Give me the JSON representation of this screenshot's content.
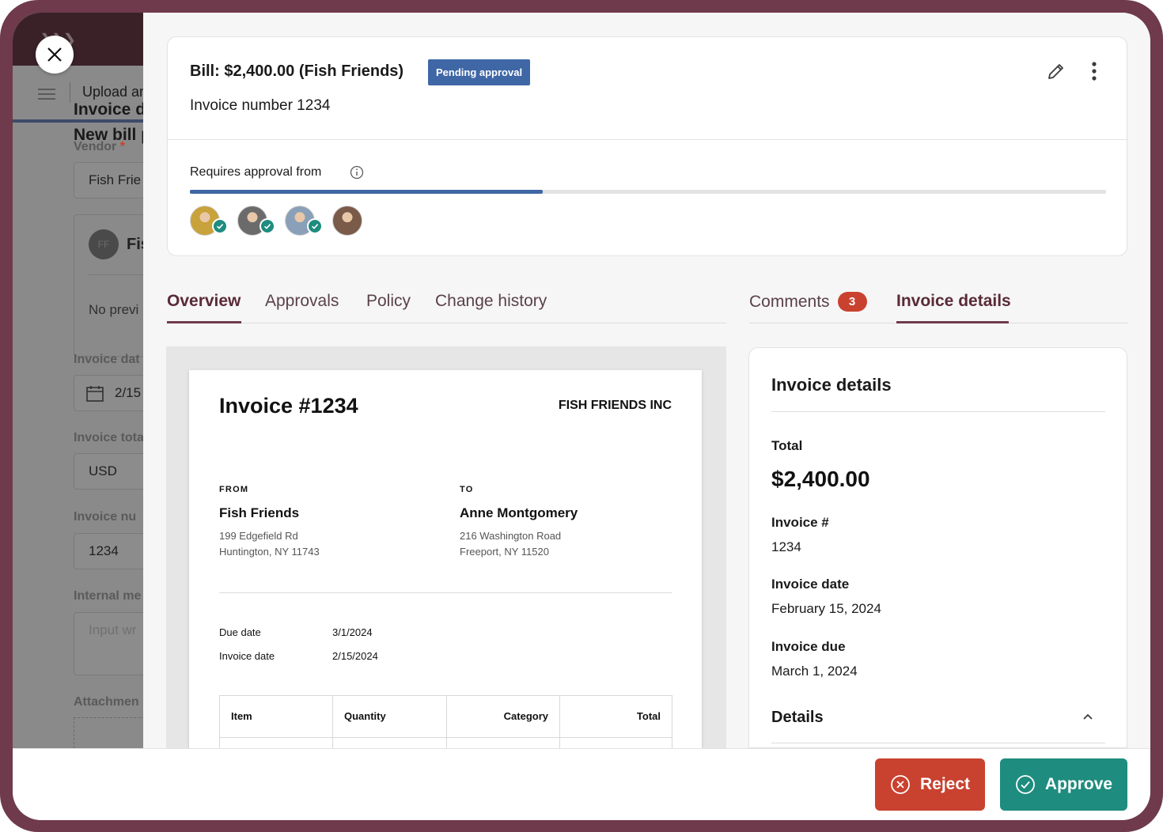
{
  "background_page": {
    "nav_title_1": "Upload an",
    "nav_title_2": "Invoice de",
    "heading": "New bill p",
    "vendor_label": "Vendor",
    "vendor_required": "*",
    "vendor_value": "Fish Frie",
    "vendor_card_initials": "FF",
    "vendor_card_name": "Fis",
    "preview_text": "No previ",
    "invoice_date_label": "Invoice dat",
    "invoice_date_value": "2/15",
    "invoice_total_label": "Invoice tota",
    "currency_value": "USD",
    "invoice_number_label": "Invoice nu",
    "invoice_number_value": "1234",
    "internal_memo_label": "Internal me",
    "internal_memo_placeholder": "Input wr",
    "attachments_label": "Attachmen"
  },
  "header": {
    "title": "Bill: $2,400.00 (Fish Friends)",
    "status": "Pending approval",
    "invoice_number": "Invoice number 1234",
    "approval_label": "Requires approval from",
    "approval_progress": 0.385,
    "approvers": [
      {
        "approved": true,
        "color": "#c8a23a"
      },
      {
        "approved": true,
        "color": "#6b6b6b"
      },
      {
        "approved": true,
        "color": "#8aa0b8"
      },
      {
        "approved": false,
        "color": "#7a5a48"
      }
    ]
  },
  "tabs_left": [
    "Overview",
    "Approvals",
    "Policy",
    "Change history"
  ],
  "tabs_right": {
    "comments_label": "Comments",
    "comments_count": "3",
    "invoice_details_label": "Invoice details"
  },
  "invoice_preview": {
    "title": "Invoice #1234",
    "company": "FISH FRIENDS INC",
    "from_label": "FROM",
    "from_name": "Fish Friends",
    "from_address_1": "199 Edgefield Rd",
    "from_address_2": "Huntington, NY 11743",
    "to_label": "TO",
    "to_name": "Anne Montgomery",
    "to_address_1": "216 Washington Road",
    "to_address_2": "Freeport, NY 11520",
    "due_date_label": "Due date",
    "due_date_value": "3/1/2024",
    "invoice_date_label": "Invoice date",
    "invoice_date_value": "2/15/2024",
    "columns": [
      "Item",
      "Quantity",
      "Category",
      "Total"
    ]
  },
  "invoice_details": {
    "title": "Invoice details",
    "total_label": "Total",
    "total_value": "$2,400.00",
    "invoice_num_label": "Invoice #",
    "invoice_num_value": "1234",
    "invoice_date_label": "Invoice date",
    "invoice_date_value": "February 15, 2024",
    "invoice_due_label": "Invoice due",
    "invoice_due_value": "March 1, 2024",
    "details_section": "Details"
  },
  "actions": {
    "reject_label": "Reject",
    "approve_label": "Approve"
  },
  "colors": {
    "frame": "#6e3a4c",
    "status_badge": "#3f67a6",
    "reject": "#c9412f",
    "approve": "#1e8c7e"
  },
  "icons": [
    "close-icon",
    "edit-pencil-icon",
    "more-vertical-icon",
    "info-icon",
    "check-icon",
    "chevron-up-icon",
    "x-circle-icon",
    "check-circle-icon",
    "calendar-icon",
    "menu-icon"
  ]
}
